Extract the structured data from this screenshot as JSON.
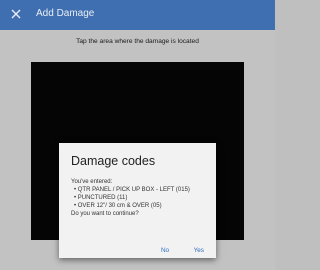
{
  "appbar": {
    "title": "Add Damage",
    "close_icon": "close-icon"
  },
  "main": {
    "instruction": "Tap the area where the damage is located"
  },
  "dialog": {
    "title": "Damage codes",
    "intro": "You've entered:",
    "codes": [
      "• QTR PANEL / PICK UP BOX - LEFT (015)",
      "• PUNCTURED (11)",
      "• OVER 12\"/ 30 cm & OVER (05)"
    ],
    "question": "Do you want to continue?",
    "no_label": "No",
    "yes_label": "Yes"
  },
  "colors": {
    "appbar": "#3f6fb0",
    "background": "#c2c2c2",
    "dialog": "#f2f2f2",
    "accent": "#2f6fc2",
    "diagram": "#050505"
  }
}
